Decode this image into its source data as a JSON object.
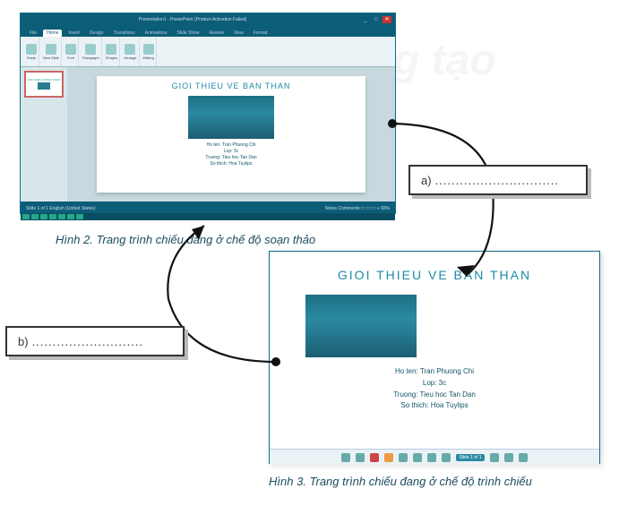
{
  "watermark_text": "chắn trời sáng tạo",
  "figure2": {
    "titlebar_center": "Presentation1 - PowerPoint (Product Activation Failed)",
    "win_min": "_",
    "win_max": "□",
    "win_close": "✕",
    "tabs": {
      "file": "File",
      "home": "Home",
      "insert": "Insert",
      "design": "Design",
      "transitions": "Transitions",
      "animations": "Animations",
      "slideshow": "Slide Show",
      "review": "Review",
      "view": "View",
      "format": "Format"
    },
    "ribbon": {
      "paste": "Paste",
      "newslide": "New Slide",
      "font": "Font",
      "paragraph": "Paragraph",
      "shapes": "Shapes",
      "arrange": "Arrange",
      "editing": "Editing"
    },
    "thumb_title": "GIOI THIEU VE BAN THAN",
    "slide": {
      "title": "GIOI THIEU VE BAN THAN",
      "line1": "Ho ten: Tran Phuong Chi",
      "line2": "Lop: 3c",
      "line3": "Truong: Tieu hoc Tan Dan",
      "line4": "So thich: Hoa Tuylips"
    },
    "status_left": "Slide 1 of 1   English (United States)",
    "status_right": "Notes  Comments  □ □ □ □ + 60%"
  },
  "caption2": "Hình 2. Trang trình chiếu đang ở chế độ soạn thảo",
  "figure3": {
    "title": "GIOI THIEU VE BAN THAN",
    "line1": "Ho ten: Tran Phuong Chi",
    "line2": "Lop: 3c",
    "line3": "Truong: Tieu hoc Tan Dan",
    "line4": "So thich: Hoa Tuylips",
    "bar_tag": "Slide 1 of 1"
  },
  "caption3": "Hình 3. Trang trình chiếu đang ở chế độ trình chiếu",
  "answer_a": {
    "label": "a)",
    "dots": ".............................."
  },
  "answer_b": {
    "label": "b)",
    "dots": "..........................."
  }
}
